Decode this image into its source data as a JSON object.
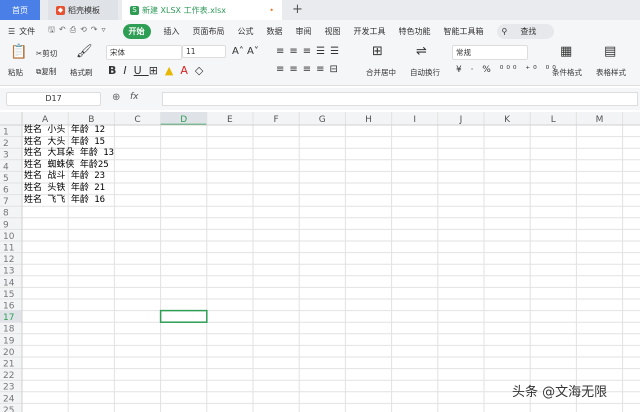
{
  "tabs": {
    "home": "首页",
    "template": "稻壳模板",
    "file": "新建 XLSX 工作表.xlsx"
  },
  "menu": {
    "file": "文件",
    "items": [
      "开始",
      "插入",
      "页面布局",
      "公式",
      "数据",
      "审阅",
      "视图",
      "开发工具",
      "特色功能",
      "智能工具箱"
    ],
    "search": "查找"
  },
  "ribbon": {
    "paste": "粘贴",
    "cut": "剪切",
    "copy": "复制",
    "format_painter": "格式刷",
    "font": "宋体",
    "font_size": "11",
    "merge": "合并居中",
    "wrap": "自动换行",
    "number_format": "常规",
    "cond_format": "条件格式",
    "table_style": "表格样式"
  },
  "formula_bar": {
    "cell_ref": "D17",
    "fx": "fx",
    "value": ""
  },
  "sheet": {
    "columns": [
      "A",
      "B",
      "C",
      "D",
      "E",
      "F",
      "G",
      "H",
      "I",
      "J",
      "K",
      "L",
      "M",
      "N"
    ],
    "row_count": 25,
    "selected": "D17",
    "cells": [
      "姓名 小头 年龄 12",
      "姓名 大头 年龄 15",
      "姓名 大耳朵 年龄 13",
      "姓名 蜘蛛侠 年龄25",
      "姓名 战斗 年龄 23",
      "姓名 头铁 年龄 21",
      "姓名 飞飞 年龄 16"
    ]
  },
  "watermark": "头条 @文海无限",
  "colors": {
    "accent": "#2f9e55",
    "home_tab": "#4a7fe8"
  }
}
